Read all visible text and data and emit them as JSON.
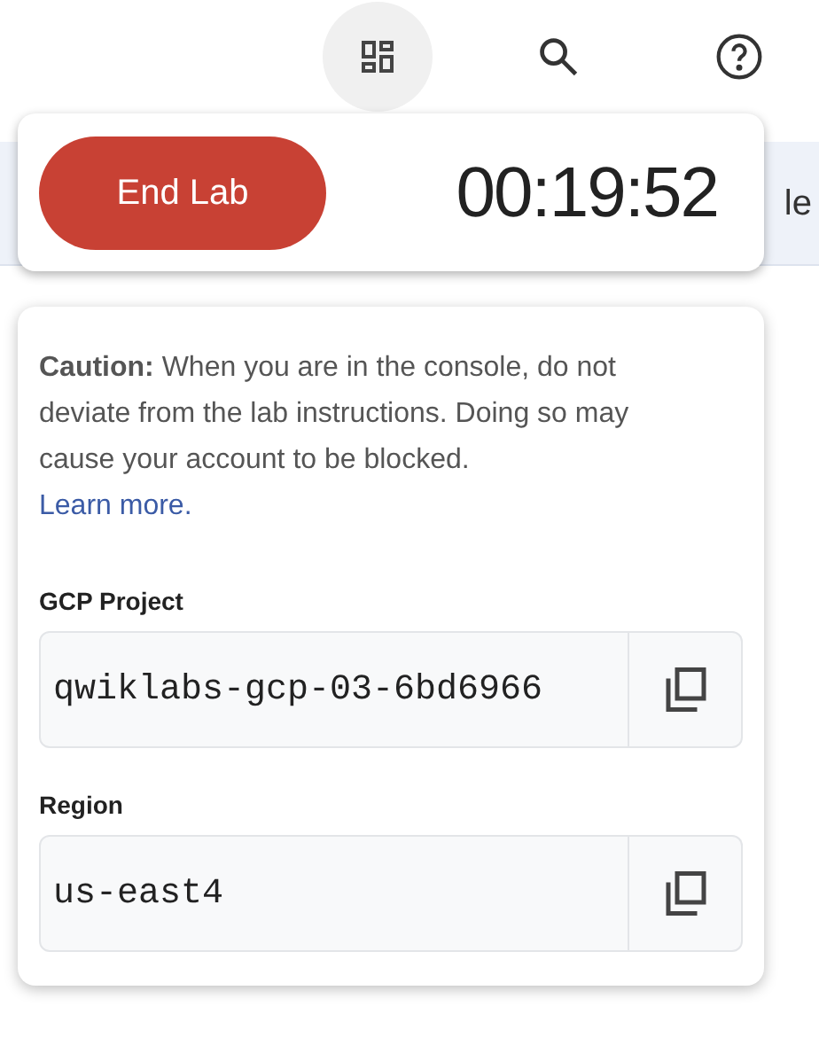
{
  "toolbar": {
    "buttons": [
      {
        "kind": "apps",
        "selected": true
      },
      {
        "kind": "search",
        "selected": false
      },
      {
        "kind": "help",
        "selected": false
      }
    ]
  },
  "background_text": "le",
  "lab_bar": {
    "end_button": "End Lab",
    "timer": "00:19:52"
  },
  "caution": {
    "text": "**Caution:** When you are in the console, do not deviate from the lab instructions. Doing so may cause your account to be blocked.",
    "link": "Learn more."
  },
  "fields": [
    {
      "label": "GCP Project",
      "value": "qwiklabs-gcp-03-6bd6966"
    },
    {
      "label": "Region",
      "value": "us-east4"
    }
  ]
}
